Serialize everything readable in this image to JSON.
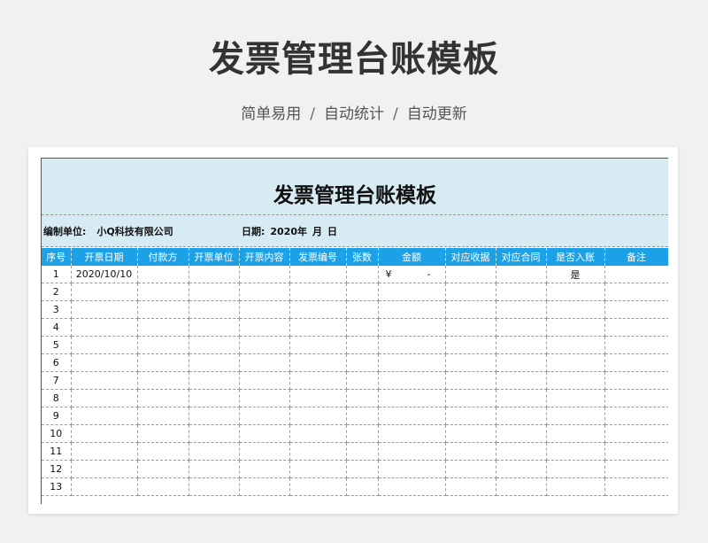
{
  "hero": {
    "title": "发票管理台账模板",
    "subtitle_parts": [
      "简单易用",
      "自动统计",
      "自动更新"
    ],
    "separator": "/"
  },
  "sheet": {
    "title": "发票管理台账模板",
    "unit_label": "编制单位:",
    "unit_value": "小Q科技有限公司",
    "date_label": "日期:",
    "date_year": "2020年",
    "date_month": "月",
    "date_day": "日",
    "columns": [
      "序号",
      "开票日期",
      "付款方",
      "开票单位",
      "开票内容",
      "发票编号",
      "张数",
      "金额",
      "对应收据",
      "对应合同",
      "是否入账",
      "备注"
    ],
    "rows": [
      {
        "no": "1",
        "date": "2020/10/10",
        "payer": "",
        "issuer": "",
        "content": "",
        "invoice_no": "",
        "count": "",
        "amount_currency": "¥",
        "amount_value": "-",
        "receipt": "",
        "contract": "",
        "booked": "是",
        "remark": ""
      },
      {
        "no": "2"
      },
      {
        "no": "3"
      },
      {
        "no": "4"
      },
      {
        "no": "5"
      },
      {
        "no": "6"
      },
      {
        "no": "7"
      },
      {
        "no": "8"
      },
      {
        "no": "9"
      },
      {
        "no": "10"
      },
      {
        "no": "11"
      },
      {
        "no": "12"
      },
      {
        "no": "13"
      }
    ]
  },
  "colors": {
    "header_bg": "#1da1e6",
    "title_band": "#d7ebf3"
  }
}
